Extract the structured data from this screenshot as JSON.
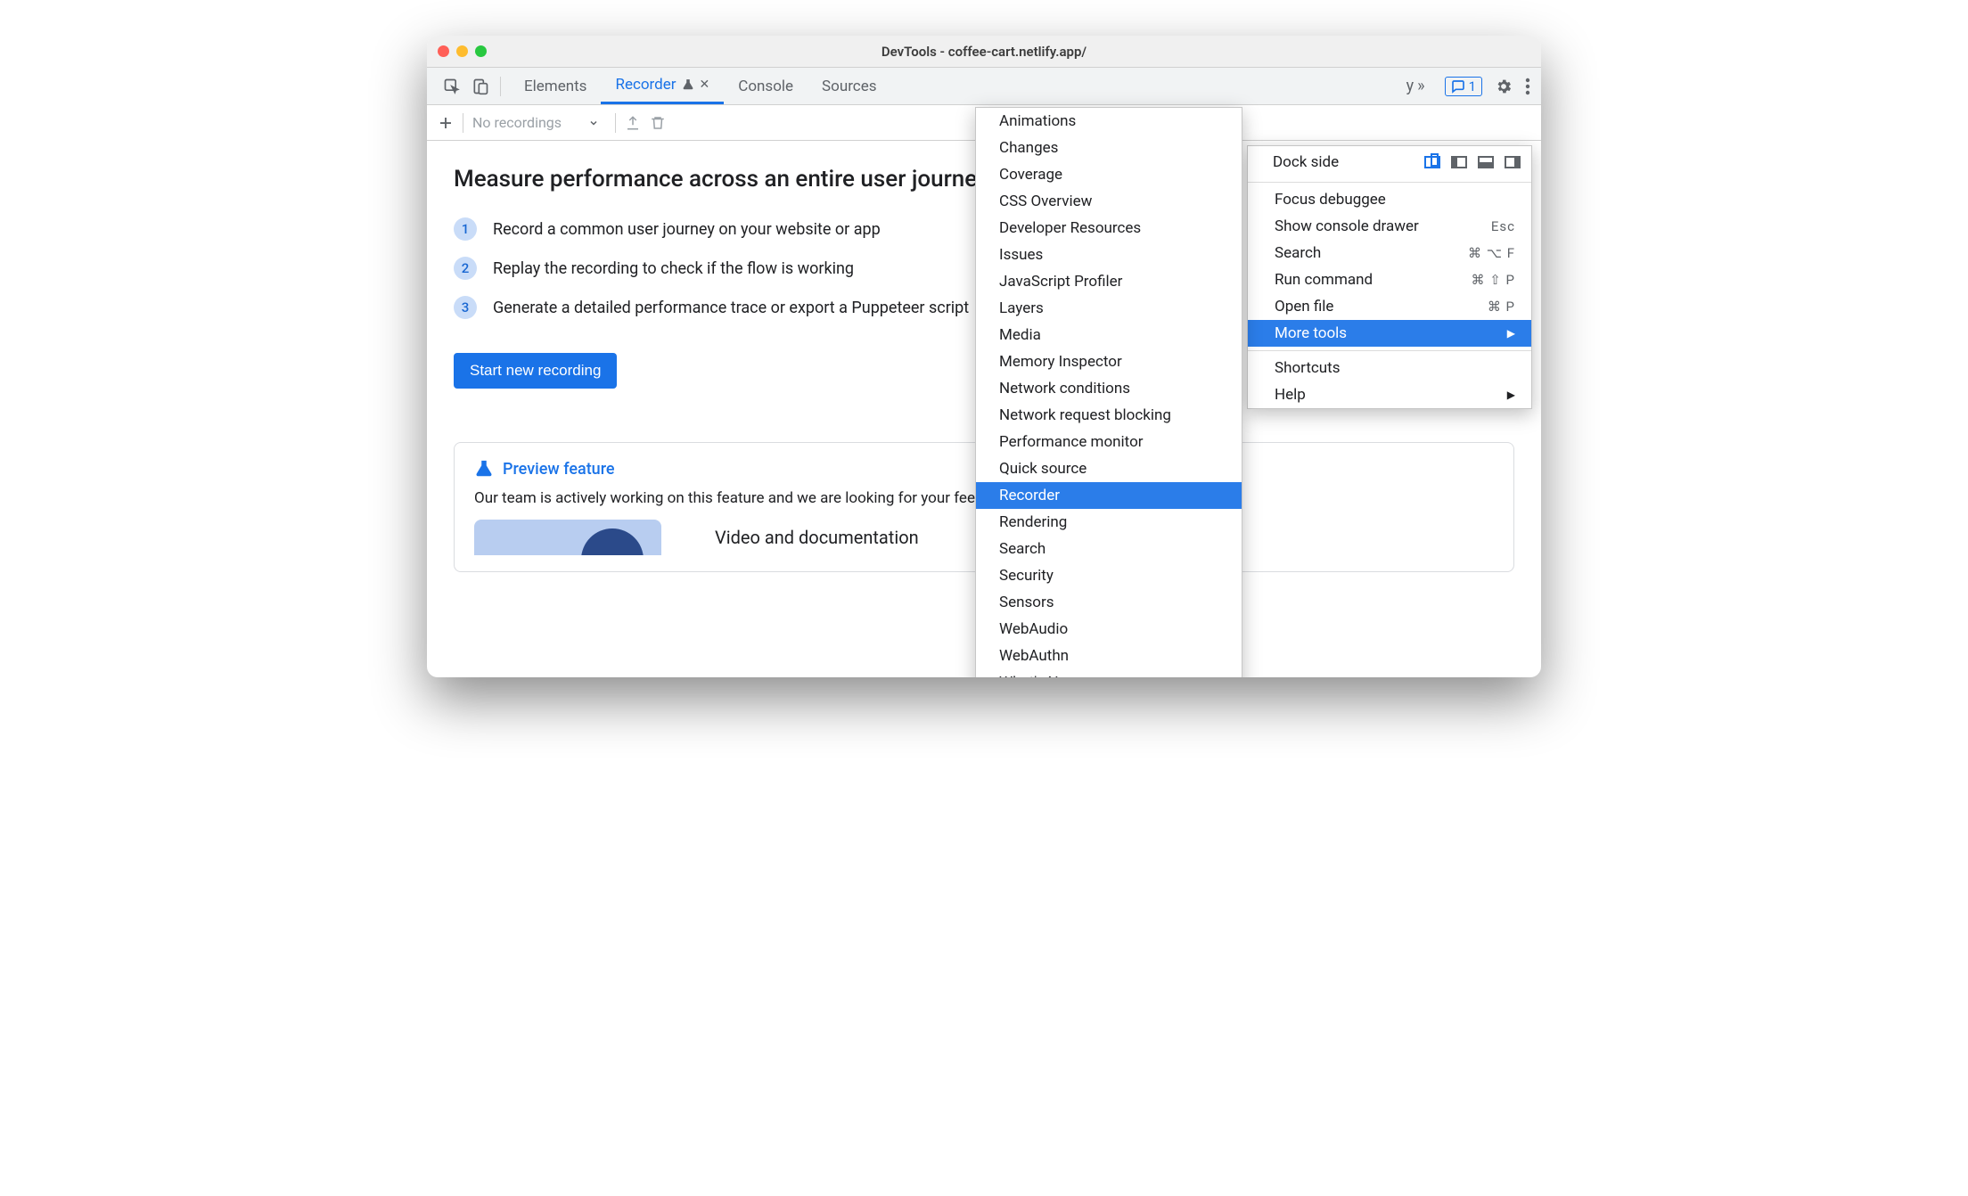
{
  "window": {
    "title": "DevTools - coffee-cart.netlify.app/"
  },
  "tabs": {
    "items": [
      {
        "label": "Elements"
      },
      {
        "label": "Recorder"
      },
      {
        "label": "Console"
      },
      {
        "label": "Sources"
      }
    ],
    "overflow_hint": "y",
    "issues_count": "1"
  },
  "toolbar": {
    "recordings_placeholder": "No recordings"
  },
  "page": {
    "title": "Measure performance across an entire user journey",
    "steps": [
      "Record a common user journey on your website or app",
      "Replay the recording to check if the flow is working",
      "Generate a detailed performance trace or export a Puppeteer script"
    ],
    "start_button": "Start new recording",
    "preview": {
      "title": "Preview feature",
      "body": "Our team is actively working on this feature and we are looking for your feedback.",
      "video_label": "Video and documentation"
    }
  },
  "main_menu": {
    "dock_label": "Dock side",
    "items": [
      {
        "label": "Focus debuggee",
        "shortcut": ""
      },
      {
        "label": "Show console drawer",
        "shortcut": "Esc"
      },
      {
        "label": "Search",
        "shortcut": "⌘ ⌥ F"
      },
      {
        "label": "Run command",
        "shortcut": "⌘ ⇧ P"
      },
      {
        "label": "Open file",
        "shortcut": "⌘ P"
      },
      {
        "label": "More tools",
        "shortcut": "",
        "submenu": true,
        "highlight": true
      },
      {
        "label": "Shortcuts",
        "shortcut": ""
      },
      {
        "label": "Help",
        "shortcut": "",
        "submenu": true
      }
    ]
  },
  "tools_menu": {
    "items": [
      "Animations",
      "Changes",
      "Coverage",
      "CSS Overview",
      "Developer Resources",
      "Issues",
      "JavaScript Profiler",
      "Layers",
      "Media",
      "Memory Inspector",
      "Network conditions",
      "Network request blocking",
      "Performance monitor",
      "Quick source",
      "Recorder",
      "Rendering",
      "Search",
      "Security",
      "Sensors",
      "WebAudio",
      "WebAuthn",
      "What's New"
    ],
    "highlight": "Recorder"
  }
}
